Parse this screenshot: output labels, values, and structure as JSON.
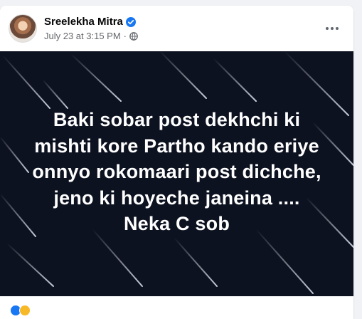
{
  "post": {
    "author": "Sreelekha Mitra",
    "timestamp": "July 23 at 3:15 PM",
    "separator": "·",
    "audience_icon": "globe-icon",
    "verified_icon": "verified-badge-icon",
    "more_icon": "more-options-icon",
    "text_lines": [
      "Baki sobar post dekhchi ki",
      "mishti kore Partho kando eriye",
      "onnyo rokomaari post dichche,",
      "jeno ki hoyeche janeina ....",
      "Neka C sob"
    ]
  },
  "colors": {
    "background": "#0d1221",
    "verified": "#1877f2",
    "text": "#ffffff",
    "meta": "#65676b"
  }
}
